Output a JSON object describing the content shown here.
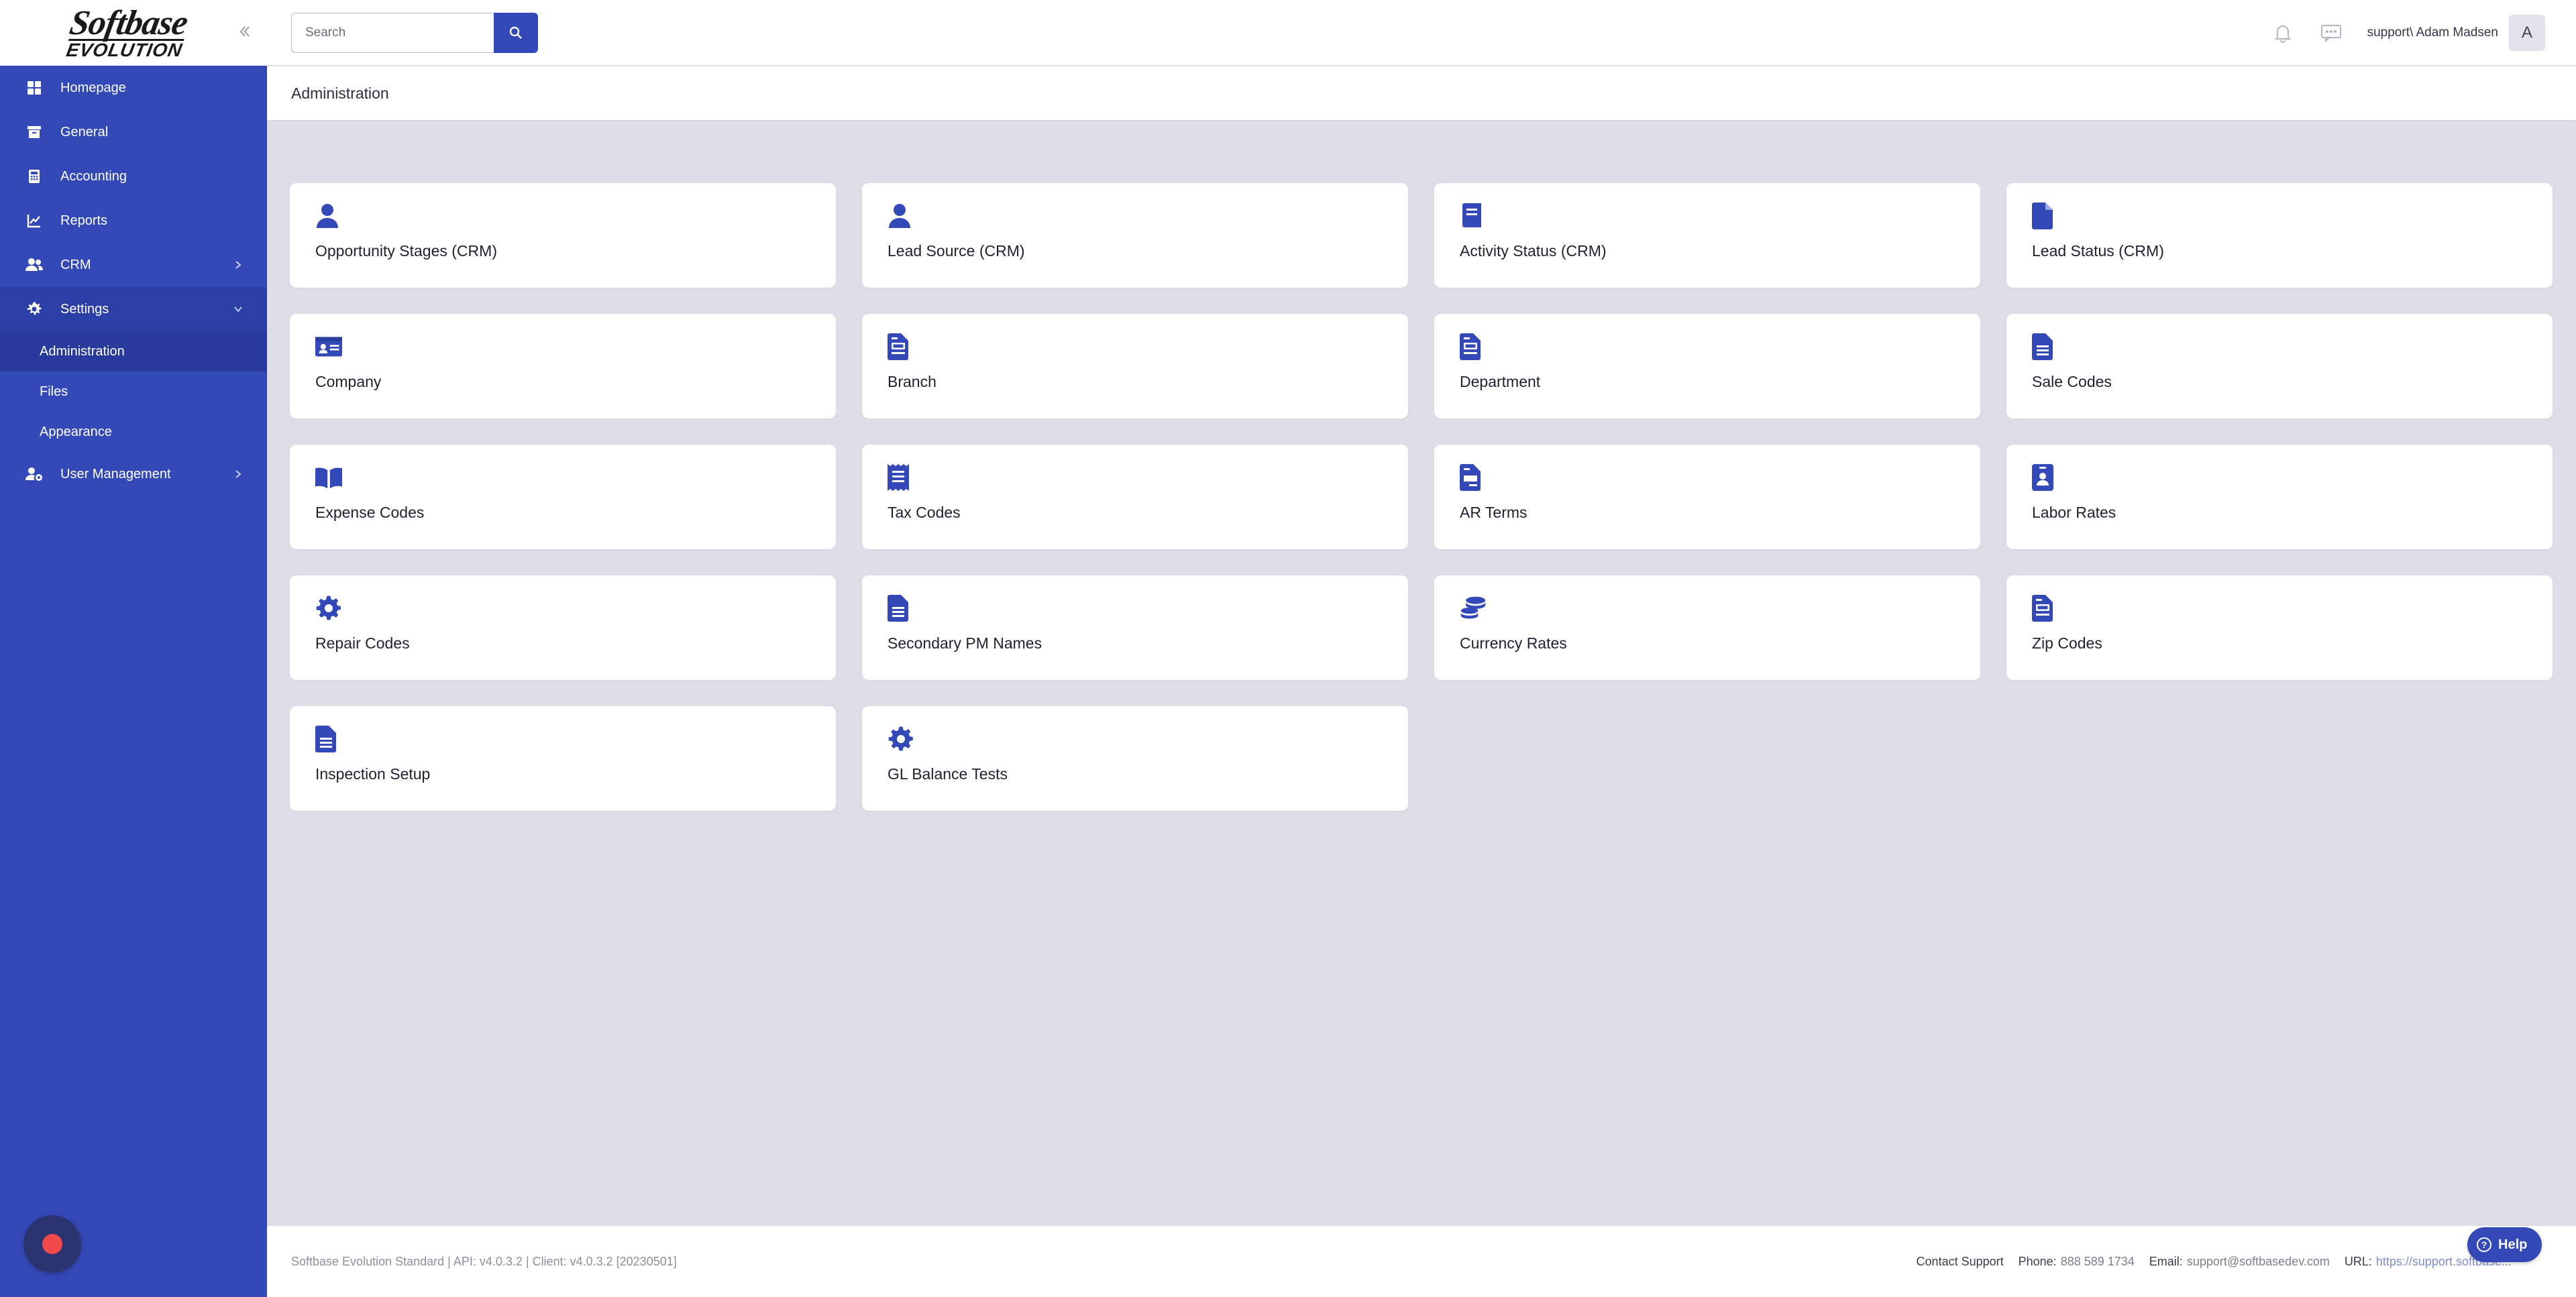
{
  "brand": {
    "logo_top": "Softbase",
    "logo_bottom": "EVOLUTION"
  },
  "sidebar": {
    "items": [
      {
        "label": "Homepage",
        "icon": "grid-icon"
      },
      {
        "label": "General",
        "icon": "archive-icon"
      },
      {
        "label": "Accounting",
        "icon": "calculator-icon"
      },
      {
        "label": "Reports",
        "icon": "chart-line-icon"
      },
      {
        "label": "CRM",
        "icon": "users-icon",
        "has_children": true
      },
      {
        "label": "Settings",
        "icon": "gear-icon",
        "expanded": true,
        "children": [
          "Administration",
          "Files",
          "Appearance"
        ],
        "active_child": "Administration"
      },
      {
        "label": "User Management",
        "icon": "user-cog-icon",
        "has_children": true
      }
    ]
  },
  "search": {
    "placeholder": "Search"
  },
  "user": {
    "name": "support\\ Adam Madsen",
    "initial": "A"
  },
  "page": {
    "title": "Administration"
  },
  "cards": [
    {
      "label": "Opportunity Stages (CRM)",
      "icon": "user-icon"
    },
    {
      "label": "Lead Source (CRM)",
      "icon": "user-icon"
    },
    {
      "label": "Activity Status (CRM)",
      "icon": "book-icon"
    },
    {
      "label": "Lead Status (CRM)",
      "icon": "file-icon"
    },
    {
      "label": "Company",
      "icon": "id-card-icon"
    },
    {
      "label": "Branch",
      "icon": "file-contract-icon"
    },
    {
      "label": "Department",
      "icon": "file-contract-icon"
    },
    {
      "label": "Sale Codes",
      "icon": "file-lines-icon"
    },
    {
      "label": "Expense Codes",
      "icon": "book-open-icon"
    },
    {
      "label": "Tax Codes",
      "icon": "receipt-icon"
    },
    {
      "label": "AR Terms",
      "icon": "file-invoice-icon"
    },
    {
      "label": "Labor Rates",
      "icon": "id-badge-icon"
    },
    {
      "label": "Repair Codes",
      "icon": "gear-icon"
    },
    {
      "label": "Secondary PM Names",
      "icon": "file-lines-icon"
    },
    {
      "label": "Currency Rates",
      "icon": "coins-icon"
    },
    {
      "label": "Zip Codes",
      "icon": "file-contract-icon"
    },
    {
      "label": "Inspection Setup",
      "icon": "file-lines-icon"
    },
    {
      "label": "GL Balance Tests",
      "icon": "gear-icon"
    }
  ],
  "footer": {
    "version": "Softbase Evolution Standard | API: v4.0.3.2 | Client: v4.0.3.2 [20230501]",
    "contact_label": "Contact Support",
    "phone_label": "Phone:",
    "phone": "888 589 1734",
    "email_label": "Email:",
    "email": "support@softbasedev.com",
    "url_label": "URL:",
    "url": "https://support.softbase..."
  },
  "help": {
    "label": "Help"
  },
  "colors": {
    "accent": "#3449b8",
    "background": "#dcdde7",
    "record": "#f04a4a"
  }
}
